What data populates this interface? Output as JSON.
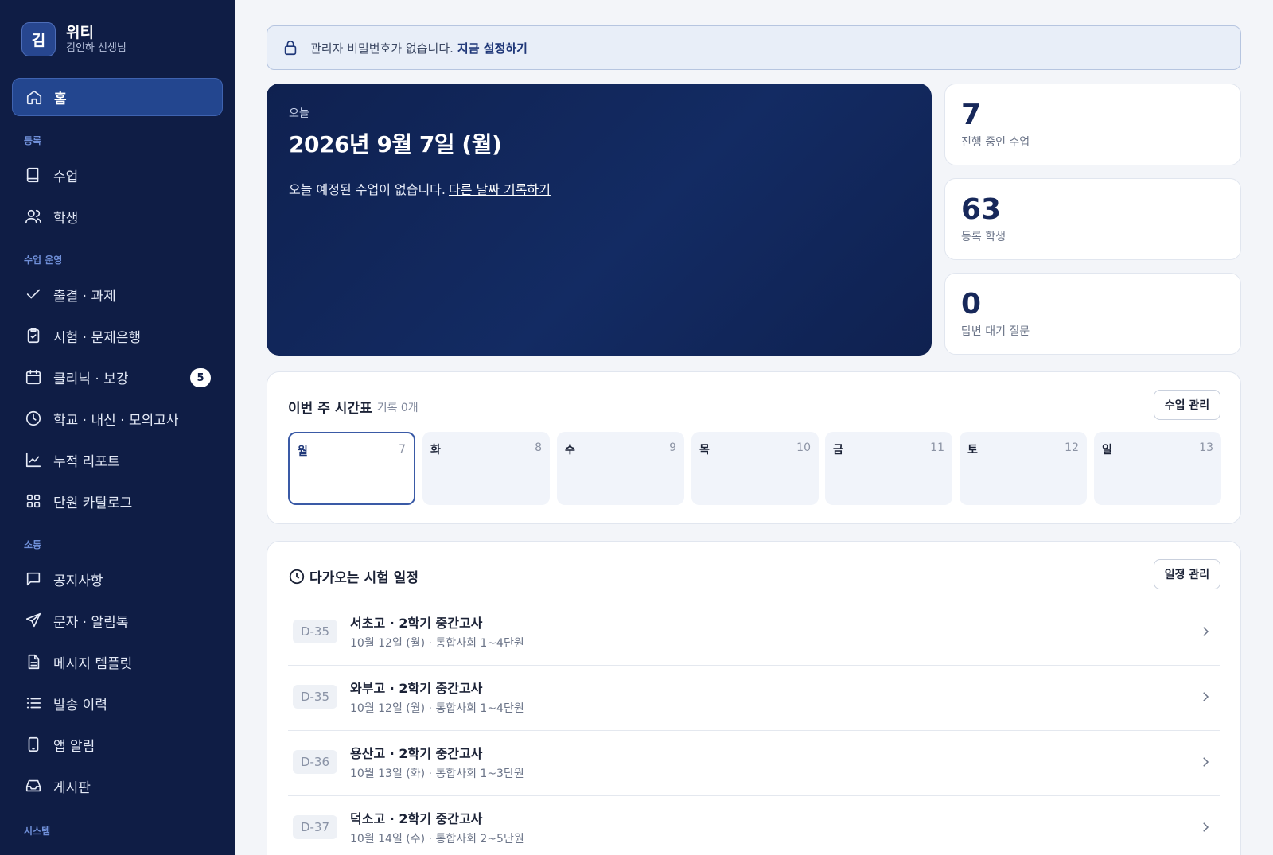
{
  "brand": {
    "avatar": "김",
    "title": "위티",
    "subtitle": "김인하 선생님"
  },
  "nav": {
    "home": "홈",
    "section_register": "등록",
    "classes": "수업",
    "students": "학생",
    "section_ops": "수업 운영",
    "attendance": "출결 · 과제",
    "exams": "시험 · 문제은행",
    "clinic": "클리닉 · 보강",
    "clinic_badge": "5",
    "school": "학교 · 내신 · 모의고사",
    "report": "누적 리포트",
    "catalog": "단원 카탈로그",
    "section_comm": "소통",
    "notice": "공지사항",
    "sms": "문자 · 알림톡",
    "template": "메시지 템플릿",
    "history": "발송 이력",
    "app_alert": "앱 알림",
    "board": "게시판",
    "section_system": "시스템"
  },
  "banner": {
    "text": "관리자 비밀번호가 없습니다.",
    "action": "지금 설정하기"
  },
  "hero": {
    "label": "오늘",
    "date": "2026년 9월 7일 (월)",
    "message": "오늘 예정된 수업이 없습니다.",
    "link": "다른 날짜 기록하기"
  },
  "stats": [
    {
      "value": "7",
      "label": "진행 중인 수업"
    },
    {
      "value": "63",
      "label": "등록 학생"
    },
    {
      "value": "0",
      "label": "답변 대기 질문"
    }
  ],
  "timetable": {
    "title": "이번 주 시간표",
    "subtitle": "기록 0개",
    "button": "수업 관리",
    "days": [
      {
        "name": "월",
        "num": "7"
      },
      {
        "name": "화",
        "num": "8"
      },
      {
        "name": "수",
        "num": "9"
      },
      {
        "name": "목",
        "num": "10"
      },
      {
        "name": "금",
        "num": "11"
      },
      {
        "name": "토",
        "num": "12"
      },
      {
        "name": "일",
        "num": "13"
      }
    ]
  },
  "exams": {
    "title": "다가오는 시험 일정",
    "button": "일정 관리",
    "items": [
      {
        "dday": "D-35",
        "title": "서초고 · 2학기 중간고사",
        "detail": "10월 12일 (월) · 통합사회 1~4단원"
      },
      {
        "dday": "D-35",
        "title": "와부고 · 2학기 중간고사",
        "detail": "10월 12일 (월) · 통합사회 1~4단원"
      },
      {
        "dday": "D-36",
        "title": "용산고 · 2학기 중간고사",
        "detail": "10월 13일 (화) · 통합사회 1~3단원"
      },
      {
        "dday": "D-37",
        "title": "덕소고 · 2학기 중간고사",
        "detail": "10월 14일 (수) · 통합사회 2~5단원"
      }
    ]
  }
}
